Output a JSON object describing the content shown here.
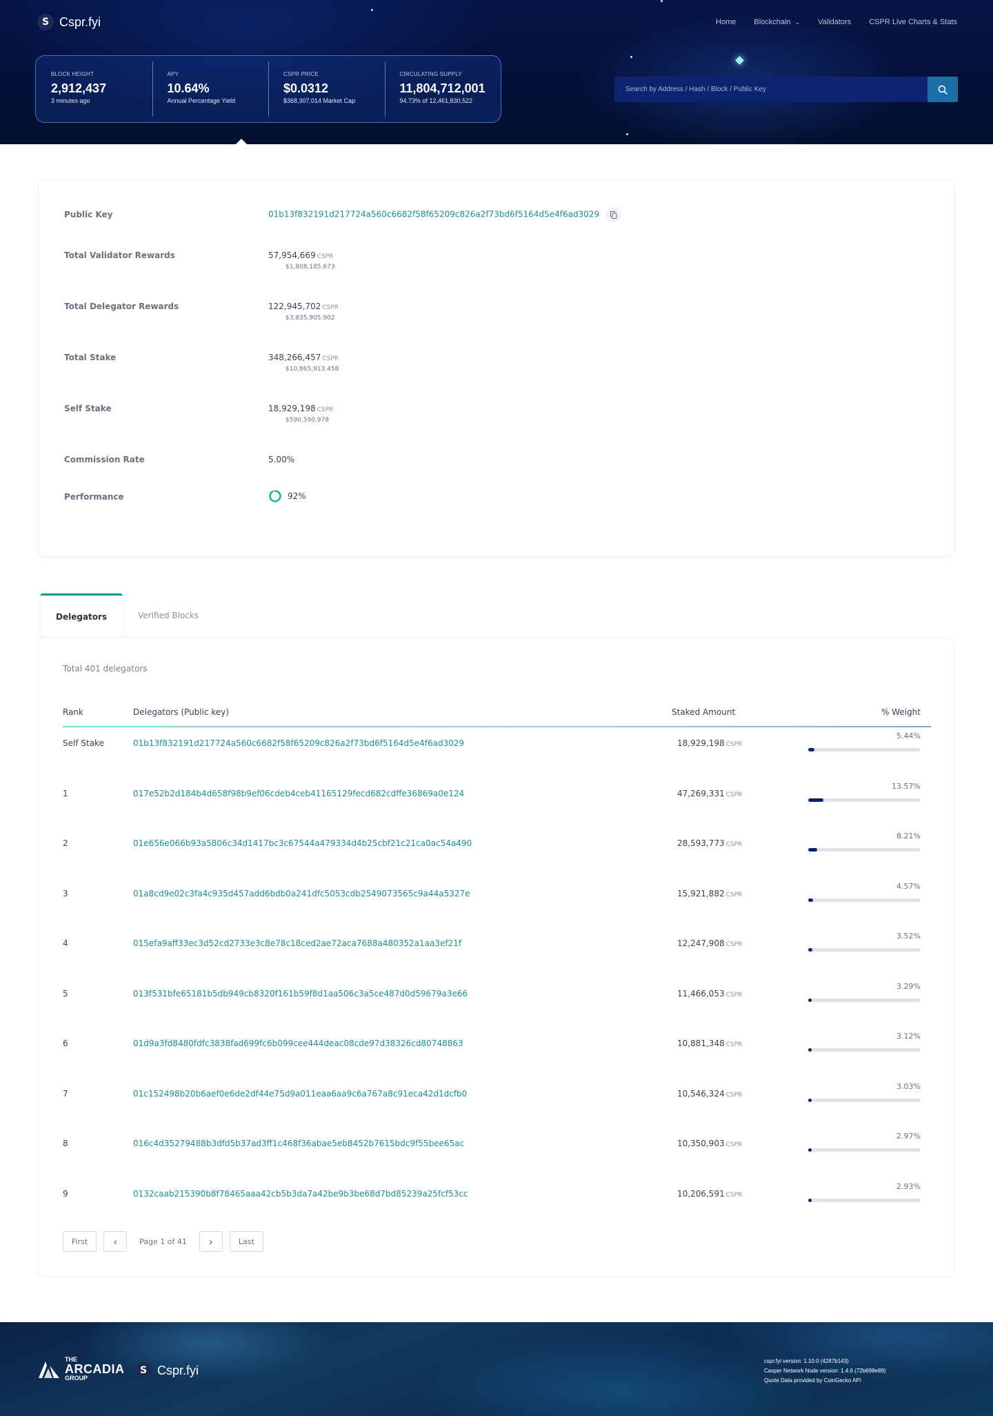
{
  "brand": {
    "name": "Cspr.fyi",
    "logo_glyph": "S"
  },
  "nav": [
    {
      "label": "Home"
    },
    {
      "label": "Blockchain",
      "has_dropdown": true
    },
    {
      "label": "Validators"
    },
    {
      "label": "CSPR Live Charts & Stats"
    }
  ],
  "stats": [
    {
      "label": "BLOCK HEIGHT",
      "value": "2,912,437",
      "sub": "3 minutes ago"
    },
    {
      "label": "APY",
      "value": "10.64%",
      "sub": "Annual Percentage Yield"
    },
    {
      "label": "CSPR PRICE",
      "value": "$0.0312",
      "sub": "$368,307,014 Market Cap"
    },
    {
      "label": "CIRCULATING SUPPLY",
      "value": "11,804,712,001",
      "sub": "94.73% of 12,461,830,522"
    }
  ],
  "search": {
    "placeholder": "Search by Address / Hash / Block / Public Key",
    "icon": "search-icon"
  },
  "validator": {
    "public_key_label": "Public Key",
    "public_key": "01b13f832191d217724a560c6682f58f65209c826a2f73bd6f5164d5e4f6ad3029",
    "rows": [
      {
        "label": "Total Validator Rewards",
        "value": "57,954,669",
        "unit": "CSPR",
        "usd": "$1,808,185.673"
      },
      {
        "label": "Total Delegator Rewards",
        "value": "122,945,702",
        "unit": "CSPR",
        "usd": "$3,835,905.902"
      },
      {
        "label": "Total Stake",
        "value": "348,266,457",
        "unit": "CSPR",
        "usd": "$10,865,913.458"
      },
      {
        "label": "Self Stake",
        "value": "18,929,198",
        "unit": "CSPR",
        "usd": "$590,590.978"
      }
    ],
    "commission_label": "Commission Rate",
    "commission": "5.00%",
    "performance_label": "Performance",
    "performance": "92%",
    "performance_fraction": 0.92
  },
  "tabs": [
    {
      "label": "Delegators",
      "active": true
    },
    {
      "label": "Verified Blocks",
      "active": false
    }
  ],
  "delegators": {
    "total_label": "Total 401 delegators",
    "columns": {
      "rank": "Rank",
      "key": "Delegators (Public key)",
      "amount": "Staked Amount",
      "weight": "% Weight"
    },
    "unit": "CSPR",
    "rows": [
      {
        "rank": "Self Stake",
        "key": "01b13f832191d217724a560c6682f58f65209c826a2f73bd6f5164d5e4f6ad3029",
        "amount": "18,929,198",
        "weight": "5.44%",
        "weight_fraction": 0.0544
      },
      {
        "rank": "1",
        "key": "017e52b2d184b4d658f98b9ef06cdeb4ceb41165129fecd682cdffe36869a0e124",
        "amount": "47,269,331",
        "weight": "13.57%",
        "weight_fraction": 0.1357
      },
      {
        "rank": "2",
        "key": "01e656e066b93a5806c34d1417bc3c67544a479334d4b25cbf21c21ca0ac54a490",
        "amount": "28,593,773",
        "weight": "8.21%",
        "weight_fraction": 0.0821
      },
      {
        "rank": "3",
        "key": "01a8cd9e02c3fa4c935d457add6bdb0a241dfc5053cdb2549073565c9a44a5327e",
        "amount": "15,921,882",
        "weight": "4.57%",
        "weight_fraction": 0.0457
      },
      {
        "rank": "4",
        "key": "015efa9aff33ec3d52cd2733e3c8e78c18ced2ae72aca7688a480352a1aa3ef21f",
        "amount": "12,247,908",
        "weight": "3.52%",
        "weight_fraction": 0.0352
      },
      {
        "rank": "5",
        "key": "013f531bfe65181b5db949cb8320f161b59f8d1aa506c3a5ce487d0d59679a3e66",
        "amount": "11,466,053",
        "weight": "3.29%",
        "weight_fraction": 0.0329
      },
      {
        "rank": "6",
        "key": "01d9a3fd8480fdfc3838fad699fc6b099cee444deac08cde97d38326cd80748863",
        "amount": "10,881,348",
        "weight": "3.12%",
        "weight_fraction": 0.0312
      },
      {
        "rank": "7",
        "key": "01c152498b20b6aef0e6de2df44e75d9a011eaa6aa9c6a767a8c91eca42d1dcfb0",
        "amount": "10,546,324",
        "weight": "3.03%",
        "weight_fraction": 0.0303
      },
      {
        "rank": "8",
        "key": "016c4d35279488b3dfd5b37ad3ff1c468f36abae5eb8452b7615bdc9f55bee65ac",
        "amount": "10,350,903",
        "weight": "2.97%",
        "weight_fraction": 0.0297
      },
      {
        "rank": "9",
        "key": "0132caab215390b8f78465aaa42cb5b3da7a42be9b3be68d7bd85239a25fcf53cc",
        "amount": "10,206,591",
        "weight": "2.93%",
        "weight_fraction": 0.0293
      }
    ]
  },
  "pagination": {
    "first": "First",
    "last": "Last",
    "page_text": "Page 1 of 41"
  },
  "footer": {
    "arcadia_the": "THE",
    "arcadia_name": "ARCADIA",
    "arcadia_group": "GROUP",
    "brand": "Cspr.fyi",
    "version": "cspr.fyi version: 1.10.0 (4287b143)",
    "node_version": "Casper Network Node version: 1.4.6 (72b698e89)",
    "quote": "Quote Data provided by CoinGecko API"
  }
}
